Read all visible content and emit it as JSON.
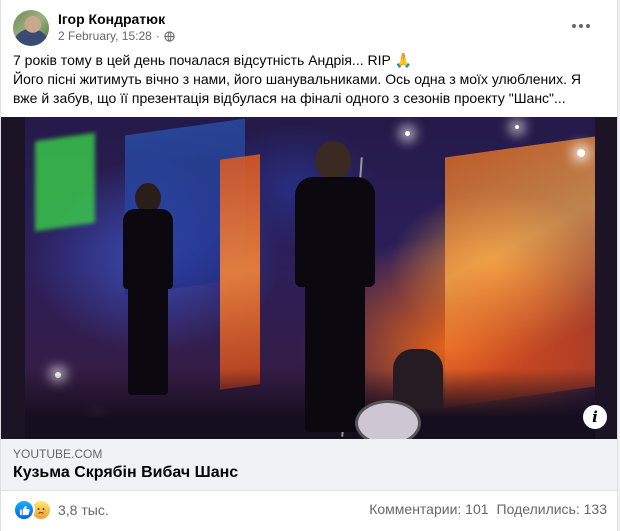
{
  "post": {
    "author": "Ігор Кондратюк",
    "date": "2 February, 15:28",
    "separator": "·",
    "text_line1": "7 років тому в цей день почалася відсутність Андрія... RIP",
    "text_line1_emoji": "🙏",
    "text_line2": "Його пісні житимуть вічно з нами, його шанувальниками. Ось одна з моїх улюблених. Я вже й забув, що її презентація відбулася на фіналі одного з сезонів проекту \"Шанс\"..."
  },
  "link_preview": {
    "domain": "YOUTUBE.COM",
    "title": "Кузьма Скрябін Вибач Шанс"
  },
  "reactions": {
    "count": "3,8 тыс.",
    "comments_label": "Комментарии: 101",
    "shares_label": "Поделились: 133"
  },
  "icons": {
    "globe": "globe-icon",
    "more": "more-options-icon",
    "info": "info-icon",
    "like": "like-reaction-icon",
    "sad": "sad-reaction-icon"
  },
  "colors": {
    "secondary_text": "#65676b",
    "like_blue": "#0062df",
    "link_box_bg": "#f0f2f5"
  }
}
